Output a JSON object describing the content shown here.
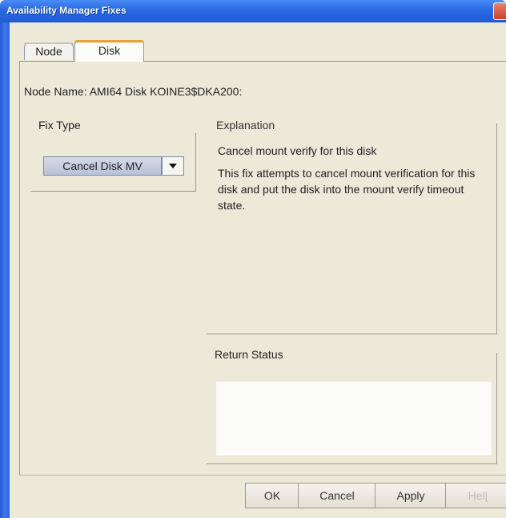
{
  "window": {
    "title": "Availability Manager Fixes"
  },
  "tabs": [
    {
      "label": "Node",
      "active": false
    },
    {
      "label": "Disk",
      "active": true
    }
  ],
  "node_line": "Node Name:  AMI64  Disk KOINE3$DKA200:",
  "fix_type": {
    "label": "Fix Type",
    "selected": "Cancel Disk MV"
  },
  "explanation": {
    "label": "Explanation",
    "title": "Cancel mount verify for this disk",
    "body": "This fix attempts to cancel mount verification for this disk and put the disk into the mount verify timeout state."
  },
  "return_status": {
    "label": "Return Status",
    "value": ""
  },
  "buttons": {
    "ok": "OK",
    "cancel": "Cancel",
    "apply": "Apply",
    "help": "Hel|"
  },
  "icons": {
    "close": "close-icon",
    "dropdown": "chevron-down-icon"
  }
}
